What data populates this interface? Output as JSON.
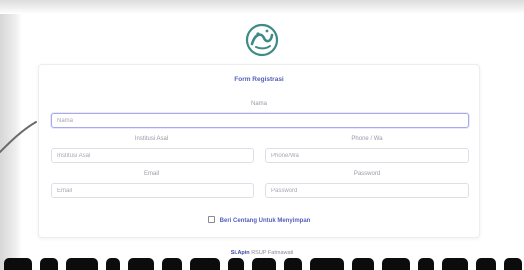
{
  "logo": {
    "icon": "calligraphy-logo-icon",
    "color": "#3e8a84"
  },
  "form": {
    "title": "Form Registrasi",
    "nama": {
      "label": "Nama",
      "placeholder": "Nama"
    },
    "institusi": {
      "label": "Institusi Asal",
      "placeholder": "Institusi Asal"
    },
    "phone": {
      "label": "Phone / Wa",
      "placeholder": "Phone/Wa"
    },
    "email": {
      "label": "Email",
      "placeholder": "Email"
    },
    "password": {
      "label": "Password",
      "placeholder": "Password"
    },
    "remember_label": "Beri Centang Untuk Menyimpan"
  },
  "footer": {
    "brand": "Si.Apin",
    "text": "RSUP Fatmawati"
  },
  "colors": {
    "accent": "#5660b8",
    "focus_border": "#a9abe8",
    "logo": "#3e8a84"
  }
}
